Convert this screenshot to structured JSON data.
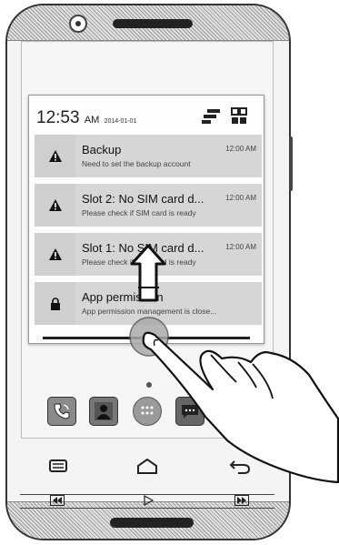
{
  "status": {
    "time": "12:53",
    "ampm": "AM",
    "date": "2014-01-01"
  },
  "notifications": [
    {
      "icon": "warning-icon",
      "title": "Backup",
      "subtitle": "Need to set the backup account",
      "time": "12:00 AM"
    },
    {
      "icon": "warning-icon",
      "title": "Slot 2: No SIM card d...",
      "subtitle": "Please check if SIM card is ready",
      "time": "12:00 AM"
    },
    {
      "icon": "warning-icon",
      "title": "Slot 1: No SIM card d...",
      "subtitle": "Please check if SIM card is ready",
      "time": "12:00 AM"
    },
    {
      "icon": "lock-icon",
      "title": "App permission",
      "subtitle": "App permission management is close...",
      "time": ""
    }
  ],
  "dock": [
    "phone-icon",
    "contacts-icon",
    "apps-icon",
    "messaging-icon"
  ],
  "nav": [
    "menu-icon",
    "home-icon",
    "back-icon"
  ],
  "colors": {
    "notif_bg": "#d6d6d6",
    "outline": "#222222"
  }
}
